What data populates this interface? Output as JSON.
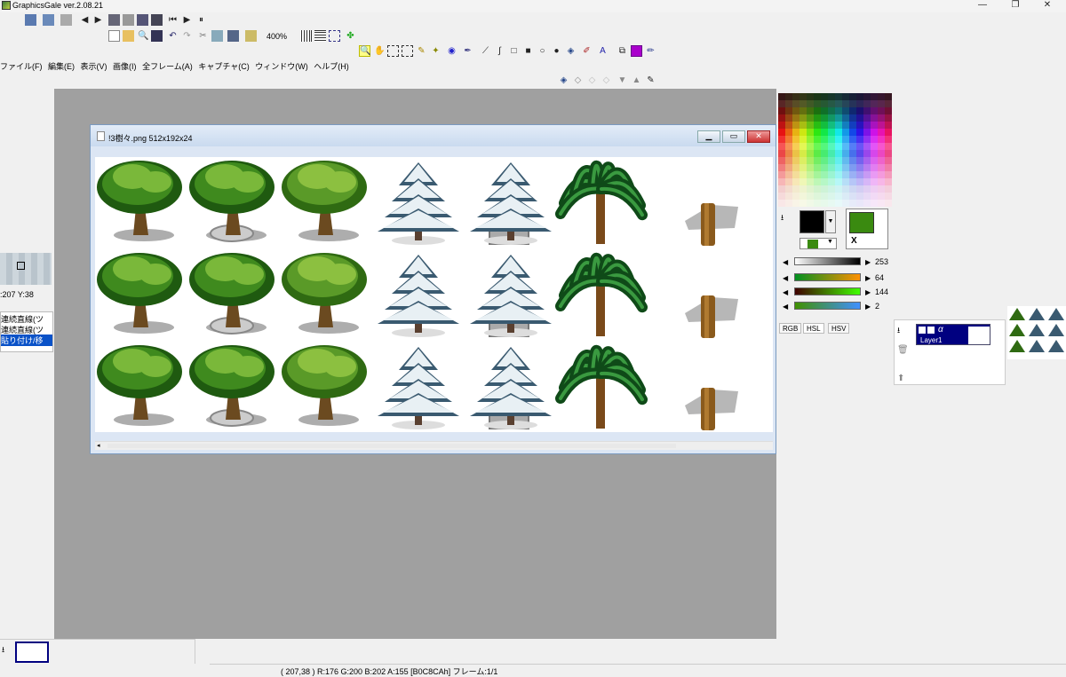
{
  "window": {
    "title": "GraphicsGale ver.2.08.21",
    "min": "—",
    "max": "❐",
    "close": "✕"
  },
  "toolbar": {
    "zoom": "400%"
  },
  "menu": [
    "ファイル(F)",
    "編集(E)",
    "表示(V)",
    "画像(I)",
    "全フレーム(A)",
    "キャプチャ(C)",
    "ウィンドウ(W)",
    "ヘルプ(H)"
  ],
  "image_window": {
    "title": "!3樹々.png 512x192x24",
    "min": "▁",
    "max": "▭",
    "close": "✕"
  },
  "color": {
    "fg_hex": "#000000",
    "bg_hex": "#ffffff",
    "sub_hex": "#3a8a10",
    "x_label": "X",
    "gray_value": "253",
    "r_value": "64",
    "g_value": "144",
    "b_value": "2"
  },
  "color_tabs": [
    "RGB",
    "HSL",
    "HSV"
  ],
  "layers": {
    "name": "Layer1"
  },
  "left_panel": {
    "coords": ":207 Y:38",
    "items": [
      "連続直線(ツ",
      "連続直線(ツ",
      "貼り付け/移"
    ]
  },
  "status": {
    "text": "( 207,38 ) R:176 G:200 B:202 A:155  [B0C8CAh]  フレーム:1/1"
  },
  "sprites": {
    "columns": [
      "round-tree",
      "potted-round-tree",
      "bushy-tree",
      "snow-pine",
      "potted-snow-pine",
      "palm-tree",
      "stump"
    ],
    "rows": 3
  }
}
